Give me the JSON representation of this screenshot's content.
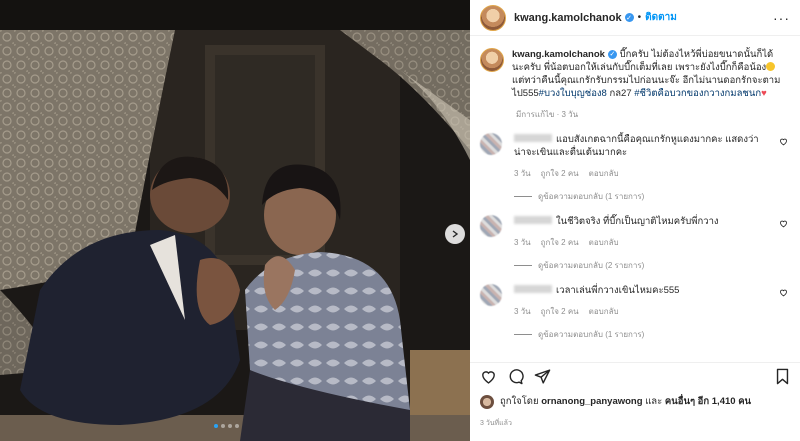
{
  "header": {
    "username": "kwang.kamolchanok",
    "separator": "•",
    "follow_label": "ติดตาม",
    "more_label": "···"
  },
  "caption": {
    "username": "kwang.kamolchanok",
    "text_1": "บี๊กครับ ไม่ต้องไหว้พี่บ่อยขนาดนั้นก็ได้นะครับ พี่น้อตบอกให้เล่นกับบี๊กเต็มที่เลย เพราะยังไงบี๊กก็คือน้อง",
    "text_2": "แต่ทว่าคืนนี้คุณเกรักรับกรรมไปก่อนนะจ๊ะ อีกไม่นานดอกรักจะตามไป555",
    "hashtag_1": "#บวงใบบุญช่อง8",
    "text_3": " กล27 ",
    "hashtag_2": "#ชีวิตคือบวกของกวางกมลชนก",
    "heart": "♥",
    "edited": "มีการแก้ไข · 3 วัน"
  },
  "comments": [
    {
      "text": "แอบสังเกตฉากนี้คือคุณเกรักหูแดงมากคะ แสดงว่าน่าจะเขินและตื่นเต้นมากคะ",
      "time": "3 วัน",
      "likes": "ถูกใจ 2 คน",
      "reply": "ตอบกลับ",
      "view_replies": "ดูข้อความตอบกลับ (1 รายการ)"
    },
    {
      "text": "ในชีวิตจริง ที่บี๊กเป็นญาติไหมครับพี่กวาง",
      "time": "3 วัน",
      "likes": "ถูกใจ 2 คน",
      "reply": "ตอบกลับ",
      "view_replies": "ดูข้อความตอบกลับ (2 รายการ)"
    },
    {
      "text": "เวลาเล่นพี่กวางเขินไหมคะ555",
      "time": "3 วัน",
      "likes": "ถูกใจ 2 คน",
      "reply": "ตอบกลับ",
      "view_replies": "ดูข้อความตอบกลับ (1 รายการ)"
    }
  ],
  "likes": {
    "prefix": "ถูกใจโดย",
    "user": "ornanong_panyawong",
    "and": "และ",
    "others": "คนอื่นๆ อีก 1,410 คน"
  },
  "timestamp": "3 วันที่แล้ว",
  "icons": [
    "verified-icon",
    "more-icon",
    "heart-icon",
    "comment-icon",
    "share-icon",
    "bookmark-icon",
    "next-arrow-icon"
  ],
  "colors": {
    "accent": "#0095f6",
    "heart": "#ed4956",
    "secondary_text": "#8e8e8e",
    "hashtag": "#00376b"
  },
  "carousel": {
    "slides": 4,
    "active": 1
  }
}
